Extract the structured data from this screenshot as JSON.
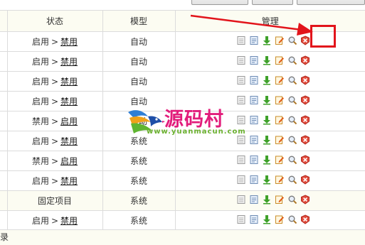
{
  "table": {
    "headers": [
      "",
      "状态",
      "模型",
      "管理"
    ],
    "status_separator": ">",
    "rows": [
      {
        "current": "启用",
        "action": "禁用",
        "model": "自动",
        "fixed_label": ""
      },
      {
        "current": "启用",
        "action": "禁用",
        "model": "自动",
        "fixed_label": ""
      },
      {
        "current": "启用",
        "action": "禁用",
        "model": "自动",
        "fixed_label": ""
      },
      {
        "current": "启用",
        "action": "禁用",
        "model": "自动",
        "fixed_label": ""
      },
      {
        "current": "禁用",
        "action": "启用",
        "model": "自动",
        "fixed_label": ""
      },
      {
        "current": "启用",
        "action": "禁用",
        "model": "系统",
        "fixed_label": ""
      },
      {
        "current": "禁用",
        "action": "启用",
        "model": "系统",
        "fixed_label": ""
      },
      {
        "current": "启用",
        "action": "禁用",
        "model": "系统",
        "fixed_label": ""
      },
      {
        "current": "",
        "action": "",
        "model": "系统",
        "fixed_label": "固定项目"
      },
      {
        "current": "启用",
        "action": "禁用",
        "model": "系统",
        "fixed_label": ""
      }
    ],
    "action_icons": [
      "view-icon",
      "document-icon",
      "download-icon",
      "edit-icon",
      "search-icon",
      "delete-icon"
    ]
  },
  "footer": {
    "text": "录"
  },
  "watermark": {
    "title": "源码村",
    "url": "www.yuanmacun.com"
  },
  "colors": {
    "highlight": "#e2141b",
    "header_bg": "#fcfcf2",
    "watermark_title": "#e21d7b",
    "watermark_url": "#6bb12f"
  }
}
